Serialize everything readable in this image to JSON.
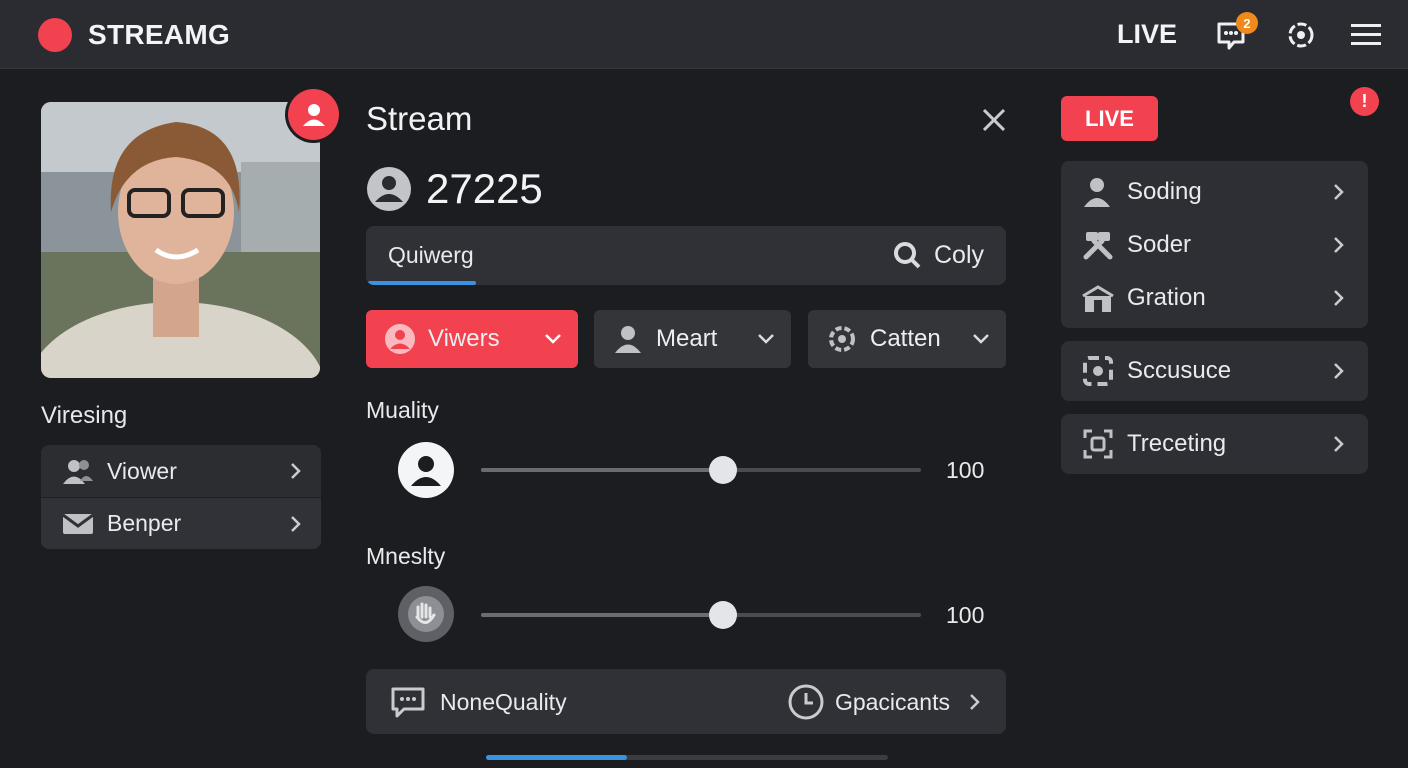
{
  "header": {
    "brand": "STREAMG",
    "live_label": "LIVE",
    "notification_count": "2",
    "icons": [
      "record-dot-icon",
      "chat-icon",
      "settings-icon",
      "menu-icon"
    ]
  },
  "profile": {
    "section_title": "Viresing",
    "items": [
      {
        "label": "Viower",
        "icon": "users-icon"
      },
      {
        "label": "Benper",
        "icon": "mail-icon"
      }
    ]
  },
  "stream": {
    "title": "Stream",
    "viewer_count": "27225",
    "search": {
      "value": "Quiwerg",
      "action_label": "Coly"
    },
    "filters": [
      {
        "label": "Viwers",
        "icon": "user-circle-icon",
        "active": true
      },
      {
        "label": "Meart",
        "icon": "user-icon",
        "active": false
      },
      {
        "label": "Catten",
        "icon": "gear-icon",
        "active": false
      }
    ],
    "sliders": [
      {
        "title": "Muality",
        "value": "100",
        "level": 0.55,
        "icon": "user-circle-icon"
      },
      {
        "title": "Mneslty",
        "value": "100",
        "level": 0.55,
        "icon": "hand-icon"
      }
    ],
    "bottom": {
      "left_label": "NoneQuality",
      "right_label": "Gpacicants"
    },
    "progress": 0.35
  },
  "sidebar": {
    "live_label": "LIVE",
    "alert": "!",
    "group1": [
      {
        "label": "Soding",
        "icon": "person-icon"
      },
      {
        "label": "Soder",
        "icon": "tools-icon"
      },
      {
        "label": "Gration",
        "icon": "box-icon"
      }
    ],
    "group2": [
      {
        "label": "Sccusuce",
        "icon": "focus-icon"
      }
    ],
    "group3": [
      {
        "label": "Treceting",
        "icon": "scan-icon"
      }
    ]
  },
  "colors": {
    "accent": "#f2414f",
    "progress": "#3a93e0",
    "badge": "#f08a1c"
  }
}
